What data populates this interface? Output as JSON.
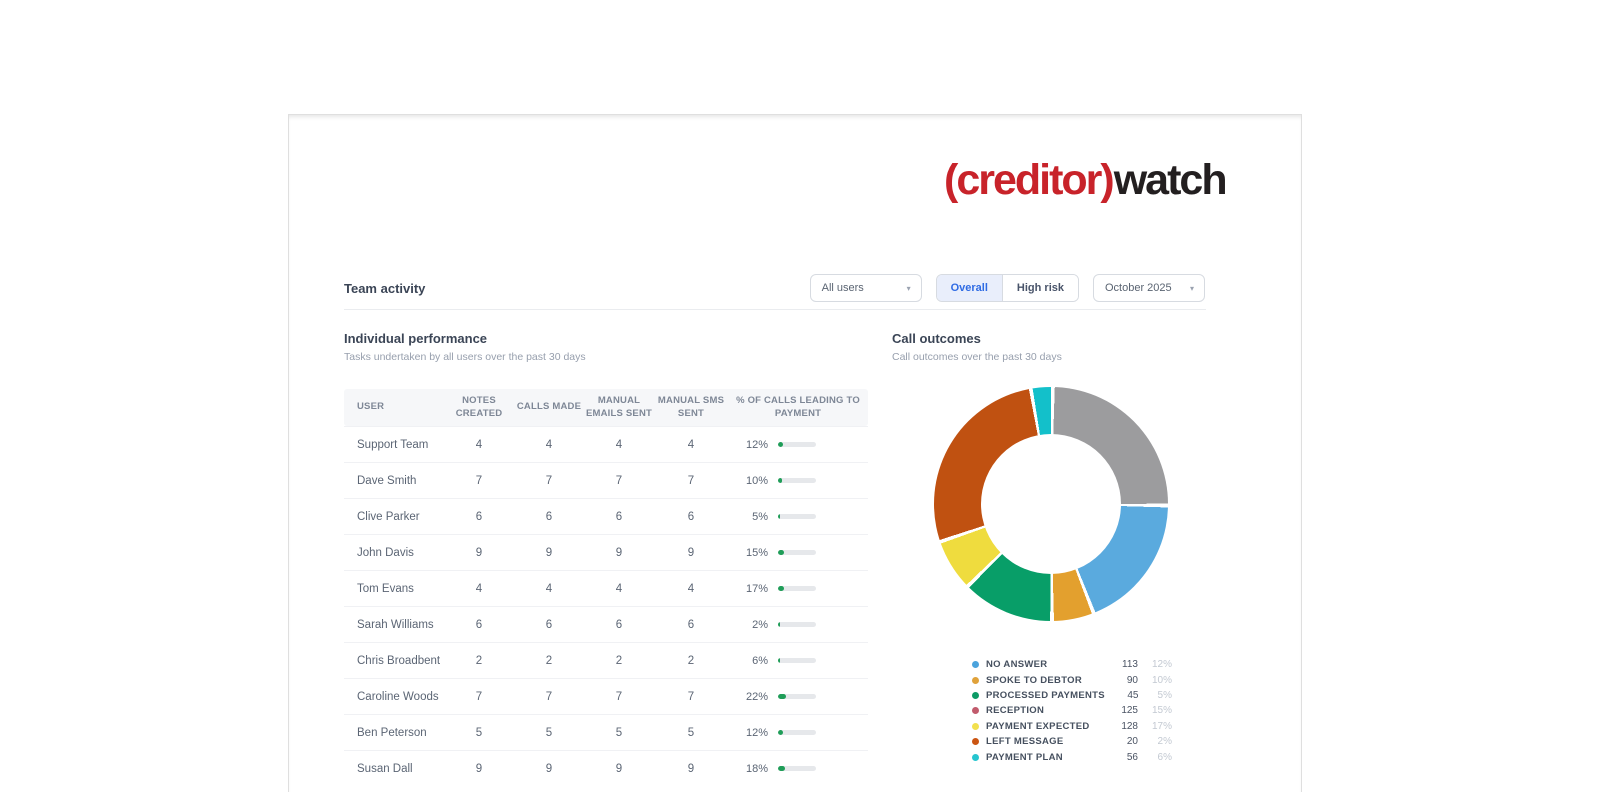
{
  "logo": {
    "creditor": "(creditor)",
    "watch": "watch",
    "red": "#c8232a",
    "dark": "#231f20"
  },
  "header": {
    "title": "Team activity",
    "users_filter": "All users",
    "toggle": [
      "Overall",
      "High risk"
    ],
    "active_toggle": "Overall",
    "month_filter": "October 2025"
  },
  "performance": {
    "title": "Individual performance",
    "subtitle": "Tasks undertaken by all users over the past 30 days",
    "columns": [
      "User",
      "Notes created",
      "Calls made",
      "Manual emails sent",
      "Manual SMS sent",
      "% of calls leading to payment"
    ],
    "rows": [
      {
        "user": "Support Team",
        "notes": 4,
        "calls": 4,
        "emails": 4,
        "sms": 4,
        "pct": 12
      },
      {
        "user": "Dave Smith",
        "notes": 7,
        "calls": 7,
        "emails": 7,
        "sms": 7,
        "pct": 10
      },
      {
        "user": "Clive Parker",
        "notes": 6,
        "calls": 6,
        "emails": 6,
        "sms": 6,
        "pct": 5
      },
      {
        "user": "John Davis",
        "notes": 9,
        "calls": 9,
        "emails": 9,
        "sms": 9,
        "pct": 15
      },
      {
        "user": "Tom Evans",
        "notes": 4,
        "calls": 4,
        "emails": 4,
        "sms": 4,
        "pct": 17
      },
      {
        "user": "Sarah Williams",
        "notes": 6,
        "calls": 6,
        "emails": 6,
        "sms": 6,
        "pct": 2
      },
      {
        "user": "Chris Broadbent",
        "notes": 2,
        "calls": 2,
        "emails": 2,
        "sms": 2,
        "pct": 6
      },
      {
        "user": "Caroline Woods",
        "notes": 7,
        "calls": 7,
        "emails": 7,
        "sms": 7,
        "pct": 22
      },
      {
        "user": "Ben Peterson",
        "notes": 5,
        "calls": 5,
        "emails": 5,
        "sms": 5,
        "pct": 12
      },
      {
        "user": "Susan Dall",
        "notes": 9,
        "calls": 9,
        "emails": 9,
        "sms": 9,
        "pct": 18
      }
    ],
    "bar_color": "#1f9d58",
    "bar_track_color": "#e6e8eb"
  },
  "call_outcomes": {
    "title": "Call outcomes",
    "subtitle": "Call outcomes over the past 30 days"
  },
  "chart_data": {
    "type": "pie",
    "variant": "donut",
    "title": "Call outcomes",
    "legend_position": "bottom",
    "gap_deg": 1.85,
    "start_angle_deg": 0,
    "segments": [
      {
        "label": "RECEPTION",
        "count": 125,
        "pct": "15%",
        "slice_color": "#9c9c9e",
        "legend_color": "#c15b6c",
        "sweep": 88
      },
      {
        "label": "NO ANSWER",
        "count": 113,
        "pct": "12%",
        "slice_color": "#5aaade",
        "legend_color": "#4ba3dc",
        "sweep": 66
      },
      {
        "label": "SPOKE TO DEBTOR",
        "count": 90,
        "pct": "10%",
        "slice_color": "#e3a02e",
        "legend_color": "#e0a23a",
        "sweep": 19
      },
      {
        "label": "PROCESSED PAYMENTS",
        "count": 45,
        "pct": "5%",
        "slice_color": "#089e68",
        "legend_color": "#0d9b66",
        "sweep": 44
      },
      {
        "label": "PAYMENT EXPECTED",
        "count": 128,
        "pct": "17%",
        "slice_color": "#efdc3e",
        "legend_color": "#f2e04e",
        "sweep": 24
      },
      {
        "label": "LEFT MESSAGE",
        "count": 20,
        "pct": "2%",
        "slice_color": "#c05111",
        "legend_color": "#cb5512",
        "sweep": 97
      },
      {
        "label": "PAYMENT PLAN",
        "count": 56,
        "pct": "6%",
        "slice_color": "#13c0ca",
        "legend_color": "#26c5cf",
        "sweep": 9
      }
    ],
    "legend_order": [
      "NO ANSWER",
      "SPOKE TO DEBTOR",
      "PROCESSED PAYMENTS",
      "RECEPTION",
      "PAYMENT EXPECTED",
      "LEFT MESSAGE",
      "PAYMENT PLAN"
    ]
  }
}
